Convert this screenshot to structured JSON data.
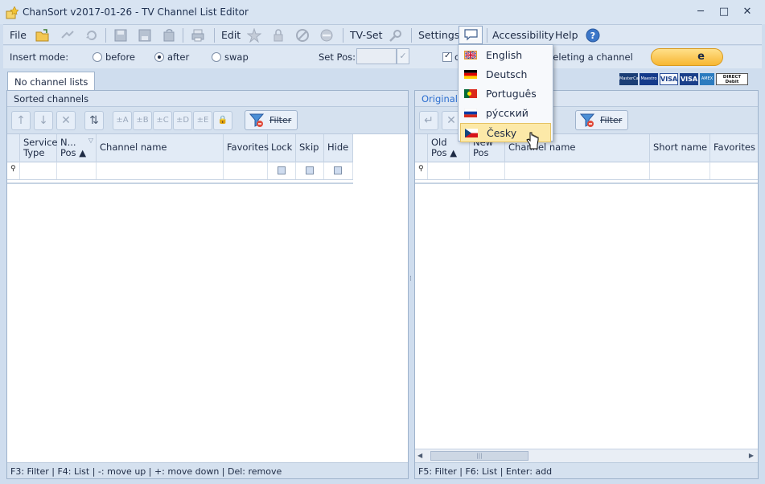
{
  "window": {
    "title": "ChanSort v2017-01-26 - TV Channel List Editor",
    "controls": [
      "─",
      "□",
      "✕"
    ]
  },
  "menu": {
    "file": "File",
    "edit": "Edit",
    "tvset": "TV-Set",
    "settings": "Settings",
    "accessibility": "Accessibility",
    "help": "Help"
  },
  "options": {
    "insert_mode_label": "Insert mode:",
    "radio_before": "before",
    "radio_after": "after",
    "radio_swap": "swap",
    "selected_mode": "after",
    "set_pos_label": "Set Pos:",
    "set_pos_value": "",
    "checkbox_partial": "c",
    "deleting_text": "deleting a channel",
    "checked": true
  },
  "tabs": {
    "no_channel_lists": "No channel lists"
  },
  "left_panel": {
    "title": "Sorted channels",
    "tool_labels": [
      "↑",
      "↓",
      "✕",
      "⇅",
      "±A",
      "±B",
      "±C",
      "±D",
      "±E",
      "🔒"
    ],
    "filter_label": "Filter",
    "columns": [
      {
        "l1": "Service",
        "l2": "Type"
      },
      {
        "l1": "N...",
        "l2": "Pos ▲"
      },
      {
        "l1": "Channel name",
        "l2": ""
      },
      {
        "l1": "Favorites",
        "l2": ""
      },
      {
        "l1": "Lock",
        "l2": ""
      },
      {
        "l1": "Skip",
        "l2": ""
      },
      {
        "l1": "Hide",
        "l2": ""
      }
    ],
    "filter_row_marker": "⚲",
    "status": "F3: Filter | F4: List | -: move up | +: move down | Del: remove"
  },
  "right_panel": {
    "title": "Original c",
    "filter_label": "Filter",
    "columns": [
      {
        "l1": "Old",
        "l2": "Pos ▲"
      },
      {
        "l1": "New",
        "l2": "Pos"
      },
      {
        "l1": "Channel name",
        "l2": ""
      },
      {
        "l1": "Short name",
        "l2": ""
      },
      {
        "l1": "Favorites",
        "l2": ""
      }
    ],
    "filter_row_marker": "⚲",
    "status": "F5: Filter | F6: List | Enter: add"
  },
  "language_menu": {
    "items": [
      {
        "label": "English",
        "flag": "uk-flag-icon"
      },
      {
        "label": "Deutsch",
        "flag": "germany-flag-icon"
      },
      {
        "label": "Português",
        "flag": "portugal-flag-icon"
      },
      {
        "label": "ру́сский",
        "flag": "russia-flag-icon"
      },
      {
        "label": "Česky",
        "flag": "czech-flag-icon"
      }
    ],
    "highlighted": "Česky"
  },
  "payment": {
    "donate_label": "e",
    "cards": [
      "MasterCard",
      "Maestro",
      "VISA",
      "VISA",
      "AMEX",
      "DIRECT Debit"
    ]
  },
  "colors": {
    "accent": "#2d6fd0",
    "highlight": "#fce9a8"
  }
}
